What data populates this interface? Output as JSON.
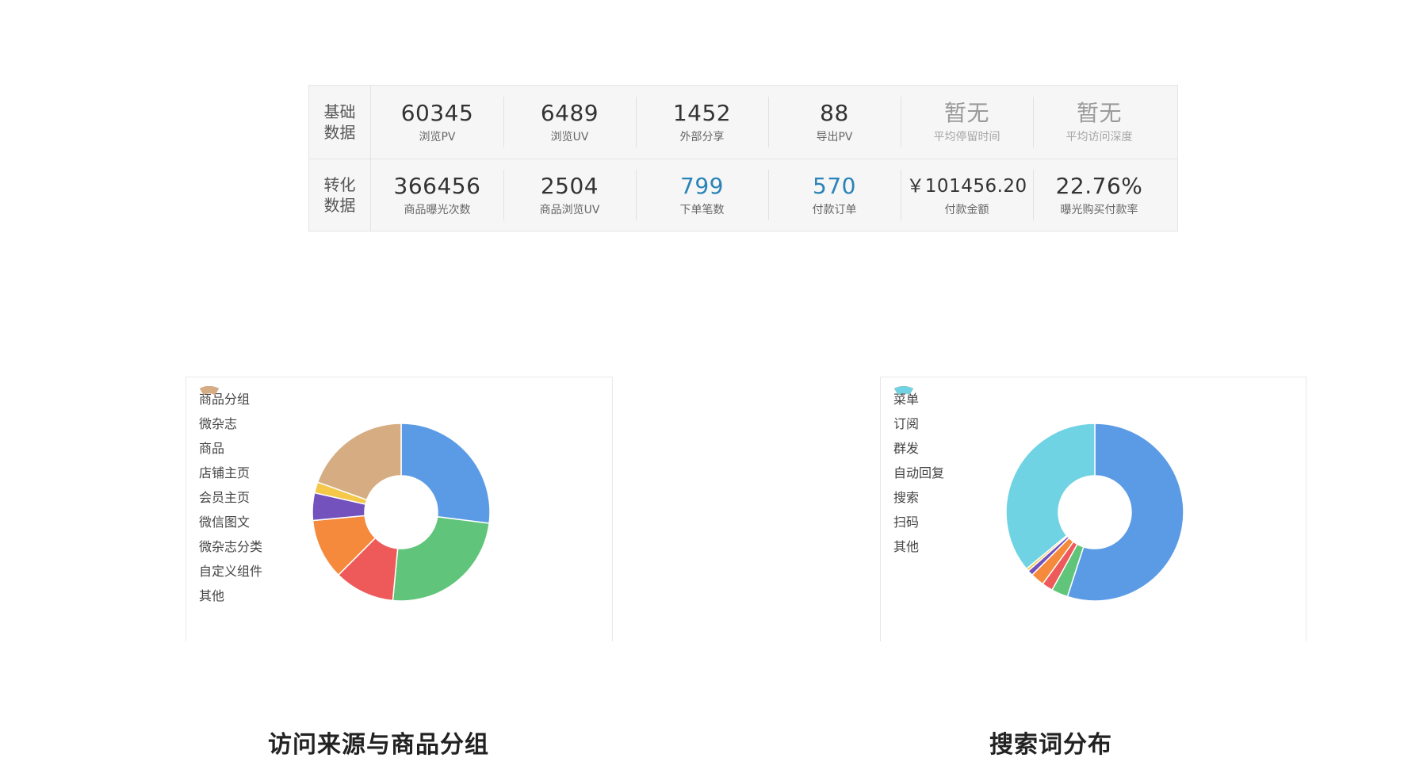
{
  "stats": {
    "rows": [
      {
        "label_line1": "基础",
        "label_line2": "数据",
        "cells": [
          {
            "value": "60345",
            "label": "浏览PV"
          },
          {
            "value": "6489",
            "label": "浏览UV"
          },
          {
            "value": "1452",
            "label": "外部分享"
          },
          {
            "value": "88",
            "label": "导出PV"
          },
          {
            "value": "暂无",
            "label": "平均停留时间"
          },
          {
            "value": "暂无",
            "label": "平均访问深度"
          }
        ]
      },
      {
        "label_line1": "转化",
        "label_line2": "数据",
        "cells": [
          {
            "value": "366456",
            "label": "商品曝光次数"
          },
          {
            "value": "2504",
            "label": "商品浏览UV"
          },
          {
            "value": "799",
            "label": "下单笔数"
          },
          {
            "value": "570",
            "label": "付款订单"
          },
          {
            "value": "￥101456.20",
            "label": "付款金额"
          },
          {
            "value": "22.76%",
            "label": "曝光购买付款率"
          }
        ]
      }
    ],
    "colors": {
      "link_value": "#2a83b8",
      "muted_value": "#9a9a9a"
    }
  },
  "chart_data": [
    {
      "type": "pie",
      "variant": "donut",
      "categories": [
        "商品分组",
        "微杂志",
        "商品",
        "店铺主页",
        "会员主页",
        "微信图文",
        "微杂志分类",
        "自定义组件",
        "其他"
      ],
      "values": [
        27,
        24.5,
        11,
        11,
        5,
        2,
        0,
        0,
        19.5
      ],
      "colors": [
        "#5b9be6",
        "#60c57a",
        "#ee5a5a",
        "#f58a3c",
        "#7352bd",
        "#f5c84a",
        "#6fd3e3",
        "#ec7ab5",
        "#d6ad82"
      ],
      "legend": "left"
    },
    {
      "type": "pie",
      "variant": "donut",
      "categories": [
        "菜单",
        "订阅",
        "群发",
        "自动回复",
        "搜索",
        "扫码",
        "其他"
      ],
      "values": [
        55,
        3,
        2,
        2.5,
        1,
        0.5,
        36
      ],
      "colors": [
        "#5b9be6",
        "#60c57a",
        "#ee5a5a",
        "#f58a3c",
        "#7352bd",
        "#f5c84a",
        "#6fd3e3"
      ],
      "legend": "left"
    }
  ],
  "captions": {
    "left": "访问来源与商品分组",
    "right": "搜索词分布"
  }
}
